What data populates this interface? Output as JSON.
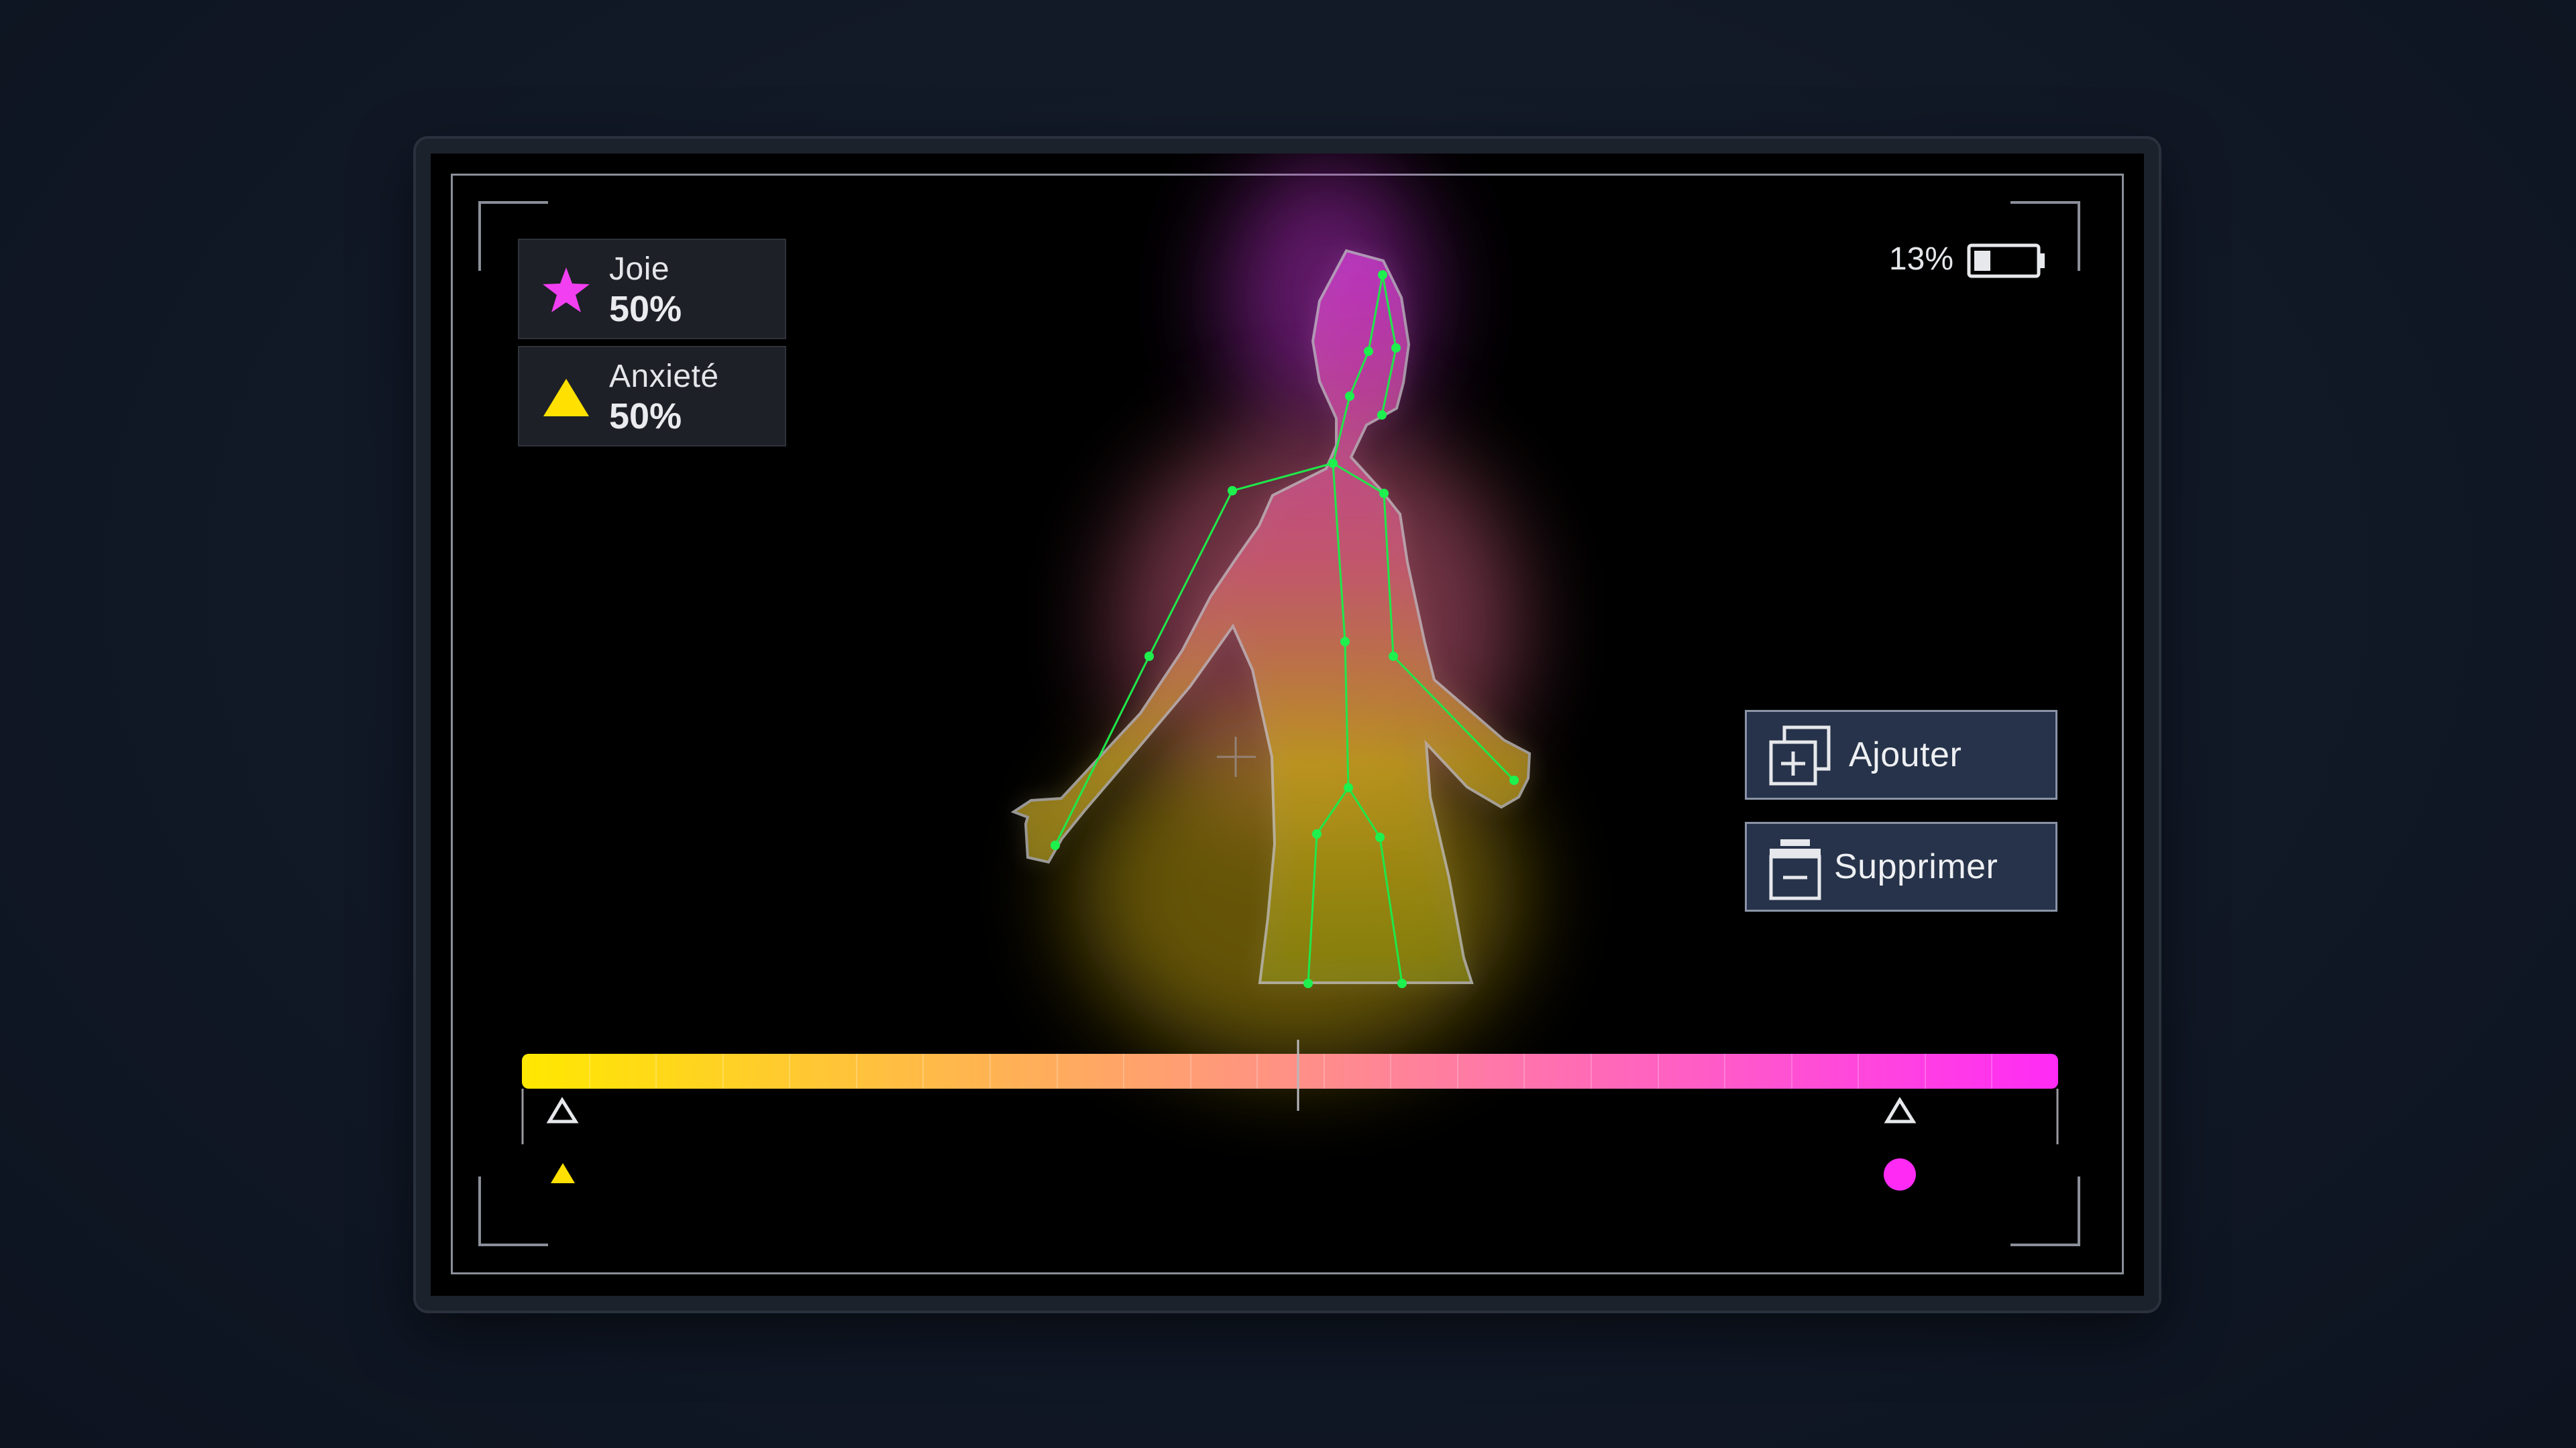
{
  "emotions": [
    {
      "label": "Joie",
      "value": "50%",
      "icon": "star-icon",
      "color": "#f23ff2"
    },
    {
      "label": "Anxieté",
      "value": "50%",
      "icon": "triangle-icon",
      "color": "#ffe000"
    }
  ],
  "status": {
    "battery_percent": "13%",
    "battery_level": 0.13
  },
  "actions": {
    "add_label": "Ajouter",
    "remove_label": "Supprimer"
  },
  "scale": {
    "left_color": "#ffe800",
    "right_color": "#ff2bf5",
    "left_marker": "triangle-icon",
    "right_marker": "circle-icon"
  }
}
